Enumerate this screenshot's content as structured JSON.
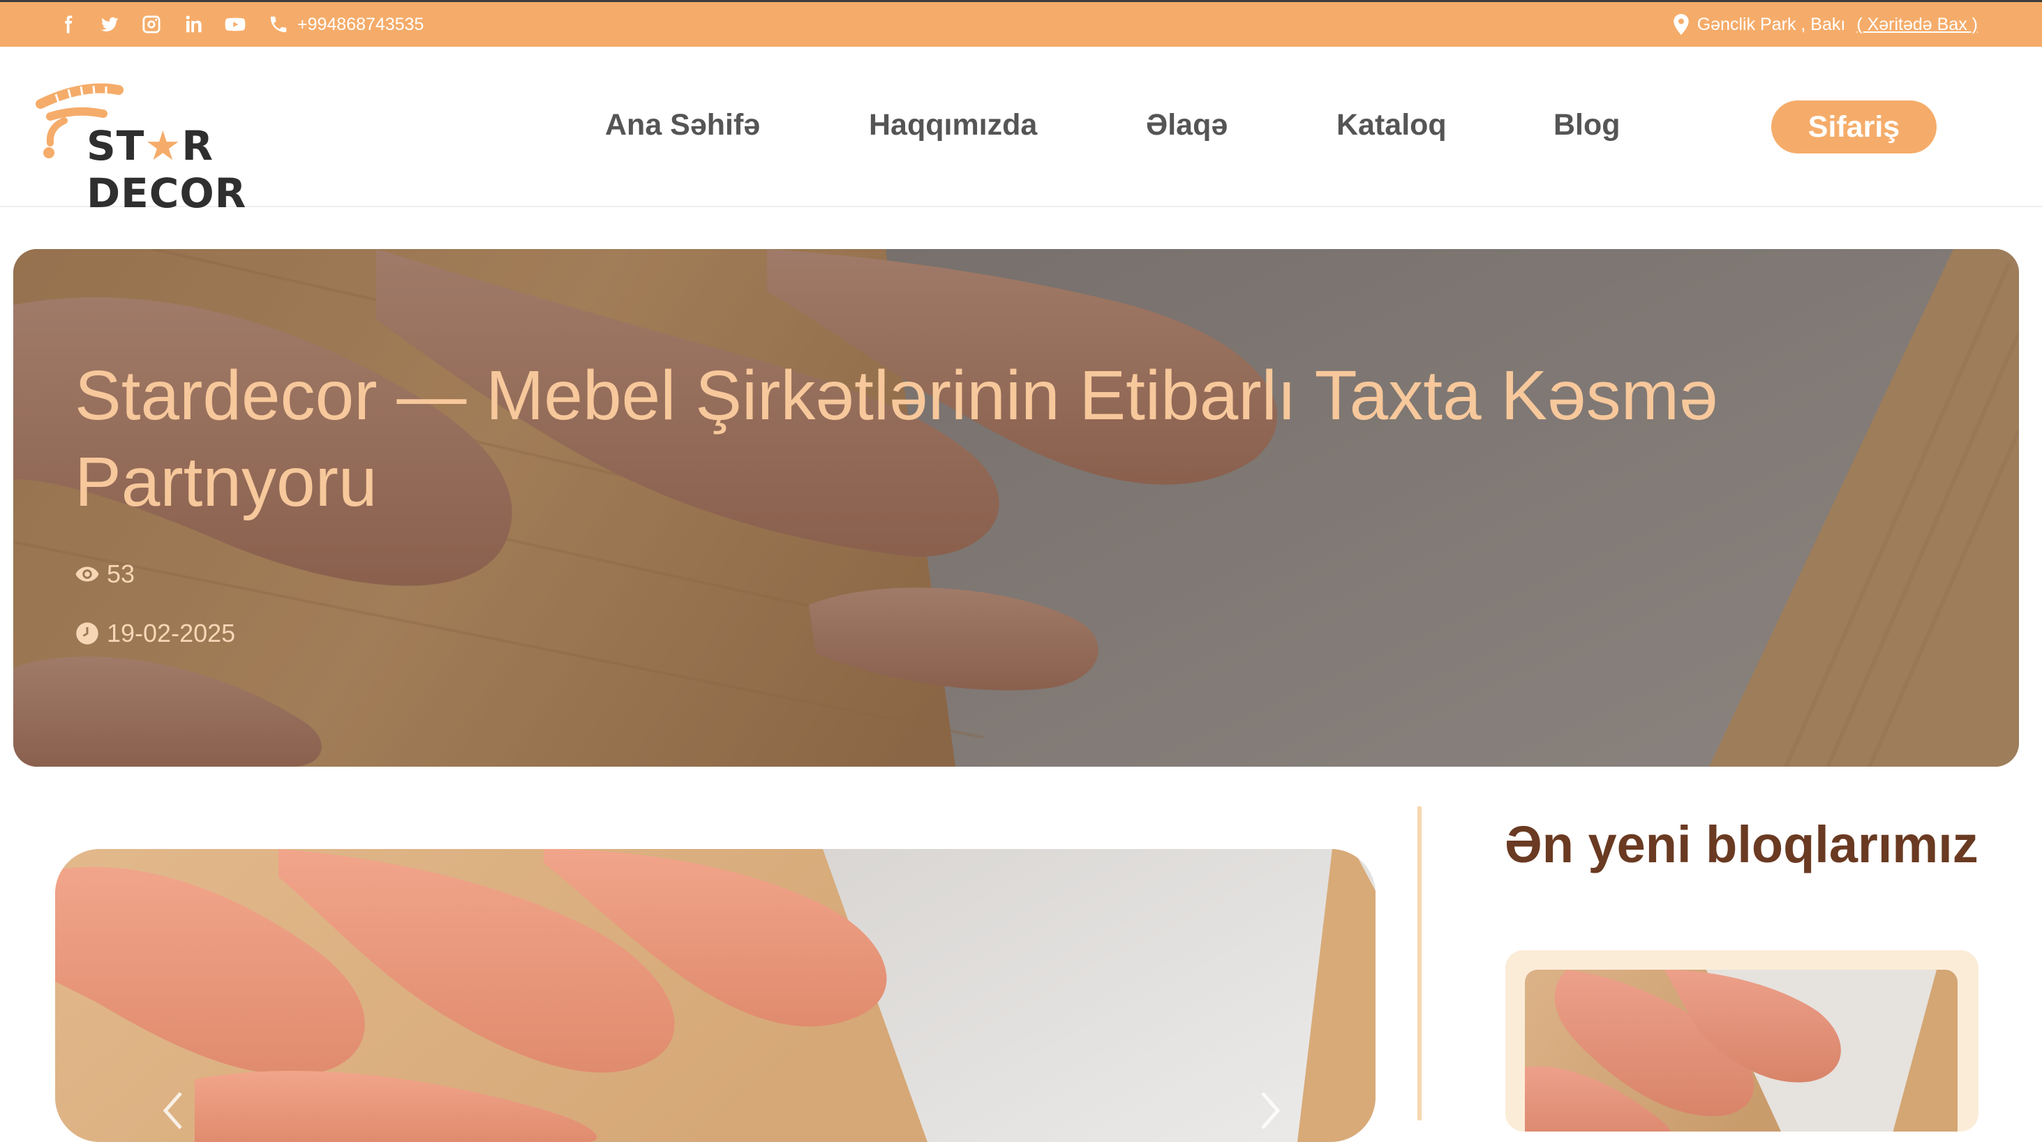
{
  "topbar": {
    "phone": "+994868743535",
    "location": "Gənclik Park , Bakı",
    "map_link": "( Xəritədə Bax )",
    "social_icons": [
      "facebook-icon",
      "twitter-icon",
      "instagram-icon",
      "linkedin-icon",
      "youtube-icon"
    ]
  },
  "header": {
    "logo_text_before": "ST",
    "logo_text_after": "R DECOR",
    "nav": [
      "Ana Səhifə",
      "Haqqımızda",
      "Əlaqə",
      "Kataloq",
      "Blog"
    ],
    "order_button": "Sifariş"
  },
  "hero": {
    "title": "Stardecor — Mebel Şirkətlərinin Etibarlı Taxta Kəsmə Partnyoru",
    "views": "53",
    "date": "19-02-2025"
  },
  "sidebar": {
    "title": "Ən yeni bloqlarımız"
  },
  "colors": {
    "accent": "#f5ac6a",
    "hero_title": "#f7c89b",
    "sidebar_title": "#6a3a22",
    "nav_text": "#555555",
    "card_bg": "#fbecd8"
  }
}
